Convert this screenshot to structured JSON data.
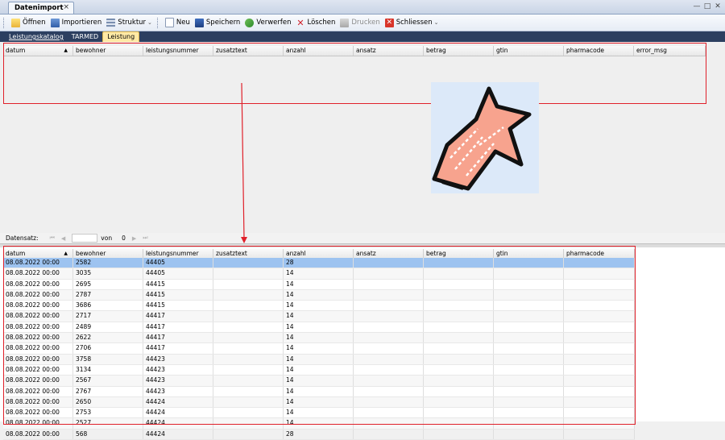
{
  "window": {
    "tab_title": "Datenimport",
    "tab_close": "×",
    "min_glyph": "—",
    "restore_glyph": "□",
    "close_glyph": "✕"
  },
  "toolbar": {
    "open": "Öffnen",
    "import": "Importieren",
    "structure": "Struktur",
    "new": "Neu",
    "save": "Speichern",
    "discard": "Verwerfen",
    "delete": "Löschen",
    "print": "Drucken",
    "close": "Schliessen",
    "more_glyph": "⌄"
  },
  "subtabs": {
    "items": [
      "Leistungskatalog",
      "TARMED",
      "Leistung"
    ],
    "active": "Leistung"
  },
  "top_grid": {
    "columns": [
      "datum",
      "bewohner",
      "leistungsnummer",
      "zusatztext",
      "anzahl",
      "ansatz",
      "betrag",
      "gtin",
      "pharmacode",
      "error_msg"
    ]
  },
  "navigator": {
    "label": "Datensatz:",
    "first": "⏮",
    "prev": "◀",
    "of_label": "von",
    "count": "0",
    "next": "▶",
    "last": "⏭"
  },
  "bottom_grid": {
    "columns": [
      "datum",
      "bewohner",
      "leistungsnummer",
      "zusatztext",
      "anzahl",
      "ansatz",
      "betrag",
      "gtin",
      "pharmacode"
    ],
    "rows": [
      [
        "08.08.2022 00:00",
        "2582",
        "44405",
        "",
        "28",
        "",
        "",
        "",
        ""
      ],
      [
        "08.08.2022 00:00",
        "3035",
        "44405",
        "",
        "14",
        "",
        "",
        "",
        ""
      ],
      [
        "08.08.2022 00:00",
        "2695",
        "44415",
        "",
        "14",
        "",
        "",
        "",
        ""
      ],
      [
        "08.08.2022 00:00",
        "2787",
        "44415",
        "",
        "14",
        "",
        "",
        "",
        ""
      ],
      [
        "08.08.2022 00:00",
        "3686",
        "44415",
        "",
        "14",
        "",
        "",
        "",
        ""
      ],
      [
        "08.08.2022 00:00",
        "2717",
        "44417",
        "",
        "14",
        "",
        "",
        "",
        ""
      ],
      [
        "08.08.2022 00:00",
        "2489",
        "44417",
        "",
        "14",
        "",
        "",
        "",
        ""
      ],
      [
        "08.08.2022 00:00",
        "2622",
        "44417",
        "",
        "14",
        "",
        "",
        "",
        ""
      ],
      [
        "08.08.2022 00:00",
        "2706",
        "44417",
        "",
        "14",
        "",
        "",
        "",
        ""
      ],
      [
        "08.08.2022 00:00",
        "3758",
        "44423",
        "",
        "14",
        "",
        "",
        "",
        ""
      ],
      [
        "08.08.2022 00:00",
        "3134",
        "44423",
        "",
        "14",
        "",
        "",
        "",
        ""
      ],
      [
        "08.08.2022 00:00",
        "2567",
        "44423",
        "",
        "14",
        "",
        "",
        "",
        ""
      ],
      [
        "08.08.2022 00:00",
        "2767",
        "44423",
        "",
        "14",
        "",
        "",
        "",
        ""
      ],
      [
        "08.08.2022 00:00",
        "2650",
        "44424",
        "",
        "14",
        "",
        "",
        "",
        ""
      ],
      [
        "08.08.2022 00:00",
        "2753",
        "44424",
        "",
        "14",
        "",
        "",
        "",
        ""
      ],
      [
        "08.08.2022 00:00",
        "2527",
        "44424",
        "",
        "14",
        "",
        "",
        "",
        ""
      ],
      [
        "08.08.2022 00:00",
        "568",
        "44424",
        "",
        "28",
        "",
        "",
        "",
        ""
      ]
    ]
  },
  "colors": {
    "highlight": "#e0202a",
    "selected_row": "#9dc3f0",
    "tab_active": "#ffe9a5",
    "subtab_bar": "#2c3f60"
  }
}
